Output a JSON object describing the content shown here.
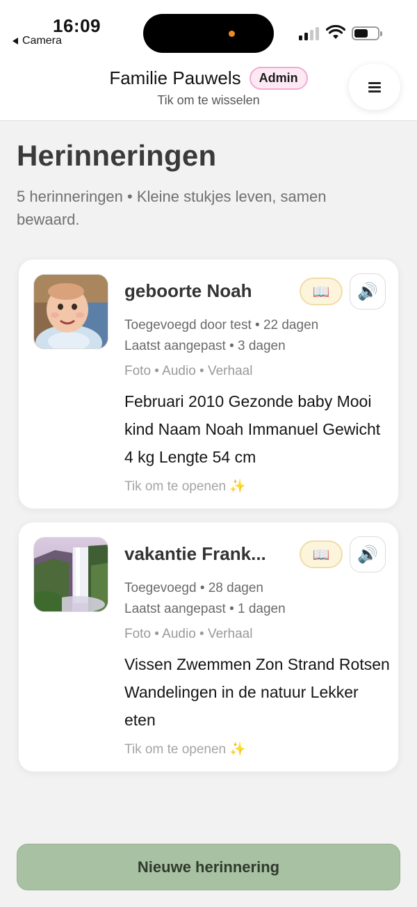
{
  "status_bar": {
    "time": "16:09",
    "back_app": "Camera"
  },
  "header": {
    "family_name": "Familie Pauwels",
    "role_badge": "Admin",
    "switch_hint": "Tik om te wisselen",
    "menu_icon": "hamburger-menu-icon"
  },
  "page": {
    "title": "Herinneringen",
    "subtitle": "5 herinneringen • Kleine stukjes leven, samen bewaard."
  },
  "memories": [
    {
      "title": "geboorte Noah",
      "added": "Toegevoegd door test • 22 dagen",
      "modified": "Laatst aangepast • 3 dagen",
      "types": "Foto • Audio • Verhaal",
      "description": "Februari 2010 Gezonde baby Mooi kind Naam Noah Immanuel Gewicht 4 kg Lengte 54 cm",
      "open_hint": "Tik om te openen ✨",
      "book_icon": "📖",
      "speaker_icon": "🔊"
    },
    {
      "title": "vakantie Frank...",
      "added": "Toegevoegd • 28 dagen",
      "modified": "Laatst aangepast • 1 dagen",
      "types": "Foto • Audio • Verhaal",
      "description": "Vissen Zwemmen Zon Strand Rotsen Wandelingen in de natuur Lekker eten",
      "open_hint": "Tik om te openen ✨",
      "book_icon": "📖",
      "speaker_icon": "🔊"
    }
  ],
  "actions": {
    "new_memory": "Nieuwe herinnering"
  },
  "colors": {
    "admin_badge_bg": "#fde9f4",
    "admin_badge_border": "#f4a9d1",
    "book_btn_bg": "#fdf4dc",
    "primary_button": "#a8c1a2",
    "background": "#f2f2f2"
  }
}
